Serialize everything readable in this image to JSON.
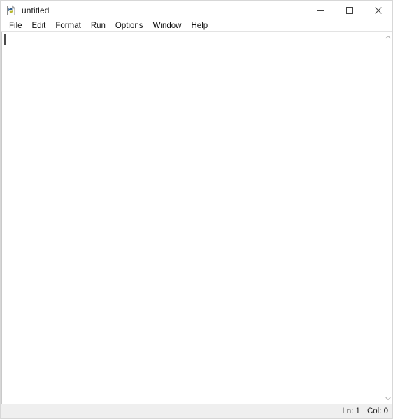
{
  "window": {
    "title": "untitled",
    "app_icon": "idle-python-document-icon",
    "controls": {
      "minimize": "minimize-icon",
      "maximize": "maximize-icon",
      "close": "close-icon"
    }
  },
  "menubar": {
    "items": [
      {
        "label": "File",
        "mnemonic_index": 0
      },
      {
        "label": "Edit",
        "mnemonic_index": 0
      },
      {
        "label": "Format",
        "mnemonic_index": 2
      },
      {
        "label": "Run",
        "mnemonic_index": 0
      },
      {
        "label": "Options",
        "mnemonic_index": 0
      },
      {
        "label": "Window",
        "mnemonic_index": 0
      },
      {
        "label": "Help",
        "mnemonic_index": 0
      }
    ]
  },
  "editor": {
    "content": "",
    "caret_line": 1,
    "caret_column": 0
  },
  "scrollbar": {
    "up_arrow": "chevron-up-icon",
    "down_arrow": "chevron-down-icon"
  },
  "statusbar": {
    "line_label": "Ln: 1",
    "col_label": "Col: 0"
  },
  "colors": {
    "window_background": "#ffffff",
    "titlebar_background": "#ffffff",
    "statusbar_background": "#efefef",
    "text": "#101010",
    "caret": "#4a4a4a",
    "border": "#d7d7d7"
  }
}
